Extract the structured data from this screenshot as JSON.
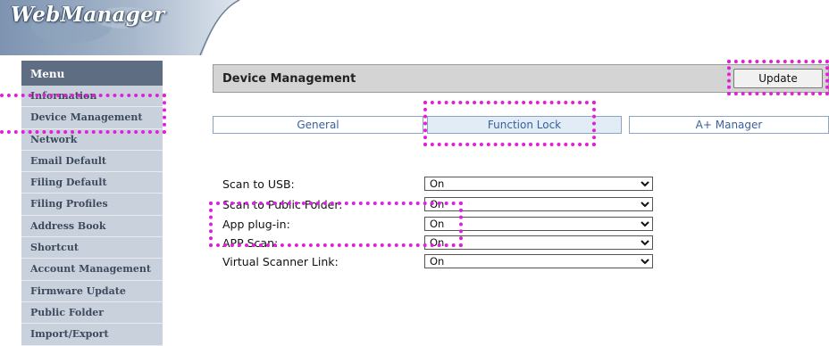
{
  "app": {
    "logo_text": "WebManager"
  },
  "menu": {
    "header": "Menu",
    "items": [
      "Information",
      "Device Management",
      "Network",
      "Email Default",
      "Filing Default",
      "Filing Profiles",
      "Address Book",
      "Shortcut",
      "Account Management",
      "Firmware Update",
      "Public Folder",
      "Import/Export"
    ]
  },
  "main": {
    "title": "Device Management",
    "update_label": "Update",
    "tabs": [
      "General",
      "Function Lock",
      "A+ Manager"
    ],
    "active_tab": "Function Lock",
    "rows": [
      {
        "label": "Scan to USB:",
        "value": "On"
      },
      {
        "label": "Scan to Public Folder:",
        "value": "On"
      },
      {
        "label": "App plug-in:",
        "value": "On"
      },
      {
        "label": "APP Scan:",
        "value": "On"
      },
      {
        "label": "Virtual Scanner Link:",
        "value": "On"
      }
    ]
  },
  "colors": {
    "highlight": "#e21fd8",
    "menu_header": "#5f6d82",
    "menu_item_bg": "#c9d1dc",
    "tab_text": "#3a5f9a"
  }
}
